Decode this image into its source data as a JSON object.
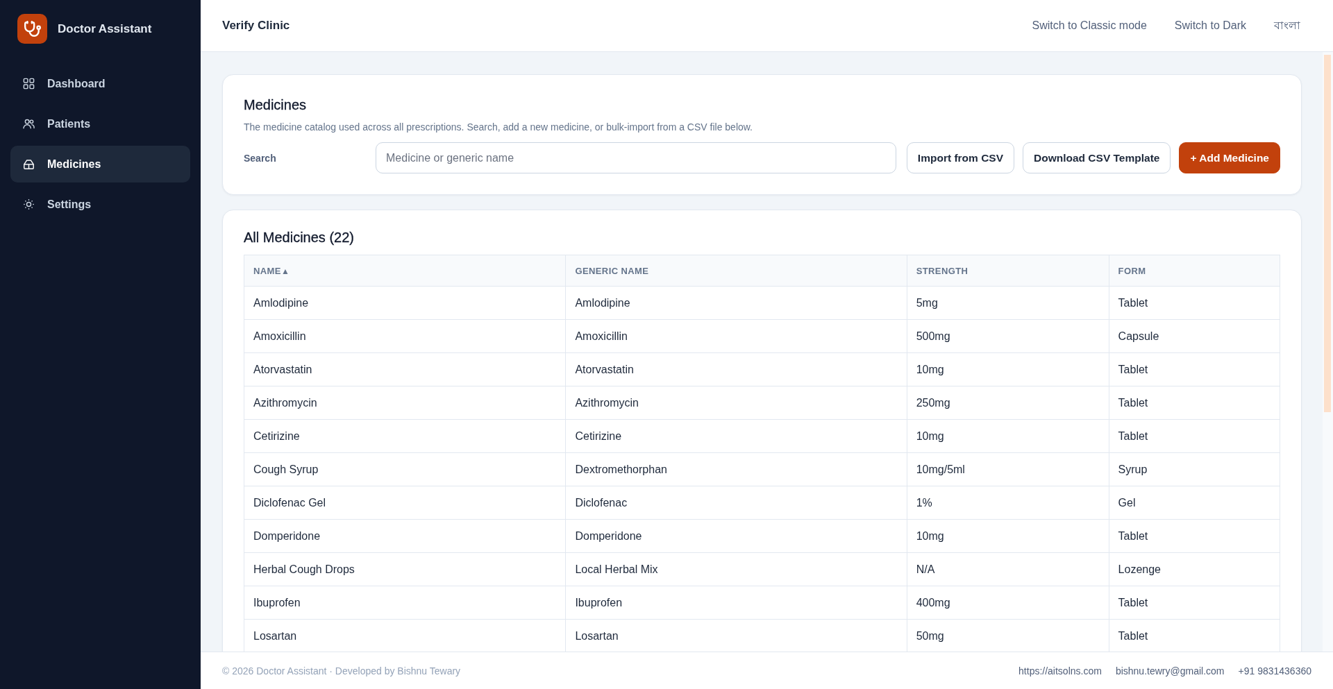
{
  "sidebar": {
    "app_name": "Doctor Assistant",
    "items": [
      {
        "label": "Dashboard",
        "selected": false
      },
      {
        "label": "Patients",
        "selected": false
      },
      {
        "label": "Medicines",
        "selected": true
      },
      {
        "label": "Settings",
        "selected": false
      }
    ]
  },
  "header": {
    "title": "Verify Clinic",
    "actions": [
      "Switch to Classic mode",
      "Switch to Dark",
      "বাংলা"
    ]
  },
  "medicines_panel": {
    "title": "Medicines",
    "description": "The medicine catalog used across all prescriptions. Search, add a new medicine, or bulk-import from a CSV file below.",
    "search": {
      "label": "Search",
      "placeholder": "Medicine or generic name"
    },
    "buttons": [
      {
        "label": "Import from CSV",
        "kind": "secondary"
      },
      {
        "label": "Download CSV Template",
        "kind": "secondary"
      },
      {
        "label": "+ Add Medicine",
        "kind": "primary"
      }
    ]
  },
  "table": {
    "title": "All Medicines (22)",
    "columns": [
      {
        "label": "NAME",
        "sort_mark": "▲"
      },
      {
        "label": "GENERIC NAME"
      },
      {
        "label": "STRENGTH"
      },
      {
        "label": "FORM"
      }
    ],
    "rows": [
      [
        "Amlodipine",
        "Amlodipine",
        "5mg",
        "Tablet"
      ],
      [
        "Amoxicillin",
        "Amoxicillin",
        "500mg",
        "Capsule"
      ],
      [
        "Atorvastatin",
        "Atorvastatin",
        "10mg",
        "Tablet"
      ],
      [
        "Azithromycin",
        "Azithromycin",
        "250mg",
        "Tablet"
      ],
      [
        "Cetirizine",
        "Cetirizine",
        "10mg",
        "Tablet"
      ],
      [
        "Cough Syrup",
        "Dextromethorphan",
        "10mg/5ml",
        "Syrup"
      ],
      [
        "Diclofenac Gel",
        "Diclofenac",
        "1%",
        "Gel"
      ],
      [
        "Domperidone",
        "Domperidone",
        "10mg",
        "Tablet"
      ],
      [
        "Herbal Cough Drops",
        "Local Herbal Mix",
        "N/A",
        "Lozenge"
      ],
      [
        "Ibuprofen",
        "Ibuprofen",
        "400mg",
        "Tablet"
      ],
      [
        "Losartan",
        "Losartan",
        "50mg",
        "Tablet"
      ]
    ]
  },
  "footer": {
    "copyright": "© 2026 Doctor Assistant · Developed by Bishnu Tewary",
    "links": [
      "https://aitsolns.com",
      "bishnu.tewry@gmail.com",
      "+91 9831436360"
    ]
  }
}
